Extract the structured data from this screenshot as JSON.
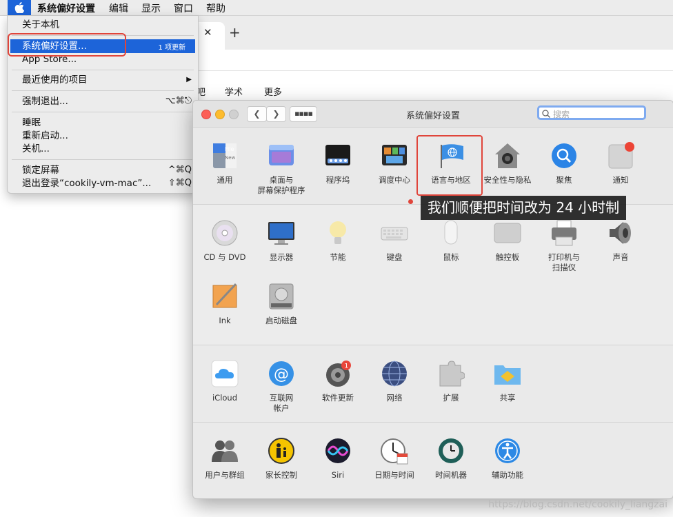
{
  "menubar": {
    "app_name": "系统偏好设置",
    "menus": [
      "编辑",
      "显示",
      "窗口",
      "帮助"
    ]
  },
  "apple_menu": {
    "items": {
      "about": "关于本机",
      "sysprefs": "系统偏好设置...",
      "sysprefs_badge": "1 项更新",
      "appstore": "App Store...",
      "recent": "最近使用的项目",
      "forcequit": "强制退出...",
      "forcequit_shortcut": "⌥⌘⎋",
      "sleep": "睡眠",
      "restart": "重新启动...",
      "shutdown": "关机...",
      "lock": "锁定屏幕",
      "lock_shortcut": "^⌘Q",
      "logout": "退出登录“cookily-vm-mac”...",
      "logout_shortcut": "⇧⌘Q"
    }
  },
  "browser": {
    "nav": [
      "吧",
      "学术",
      "更多"
    ]
  },
  "prefs": {
    "title": "系统偏好设置",
    "search_placeholder": "搜索",
    "row1": [
      "通用",
      "桌面与\n屏幕保护程序",
      "程序坞",
      "调度中心",
      "语言与地区",
      "安全性与隐私",
      "聚焦",
      "通知"
    ],
    "row2": [
      "CD 与 DVD",
      "显示器",
      "节能",
      "键盘",
      "鼠标",
      "触控板",
      "打印机与\n扫描仪",
      "声音"
    ],
    "row3": [
      "Ink",
      "启动磁盘"
    ],
    "row4": [
      "iCloud",
      "互联网\n帐户",
      "软件更新",
      "网络",
      "扩展",
      "共享"
    ],
    "row5": [
      "用户与群组",
      "家长控制",
      "Siri",
      "日期与时间",
      "时间机器",
      "辅助功能"
    ],
    "update_badge": "1"
  },
  "caption": "我们顺便把时间改为 24 小时制",
  "watermark": "https://blog.csdn.net/cookily_liangzai",
  "colors": {
    "accent": "#1d64d9",
    "highlight_box": "#e0453b"
  }
}
